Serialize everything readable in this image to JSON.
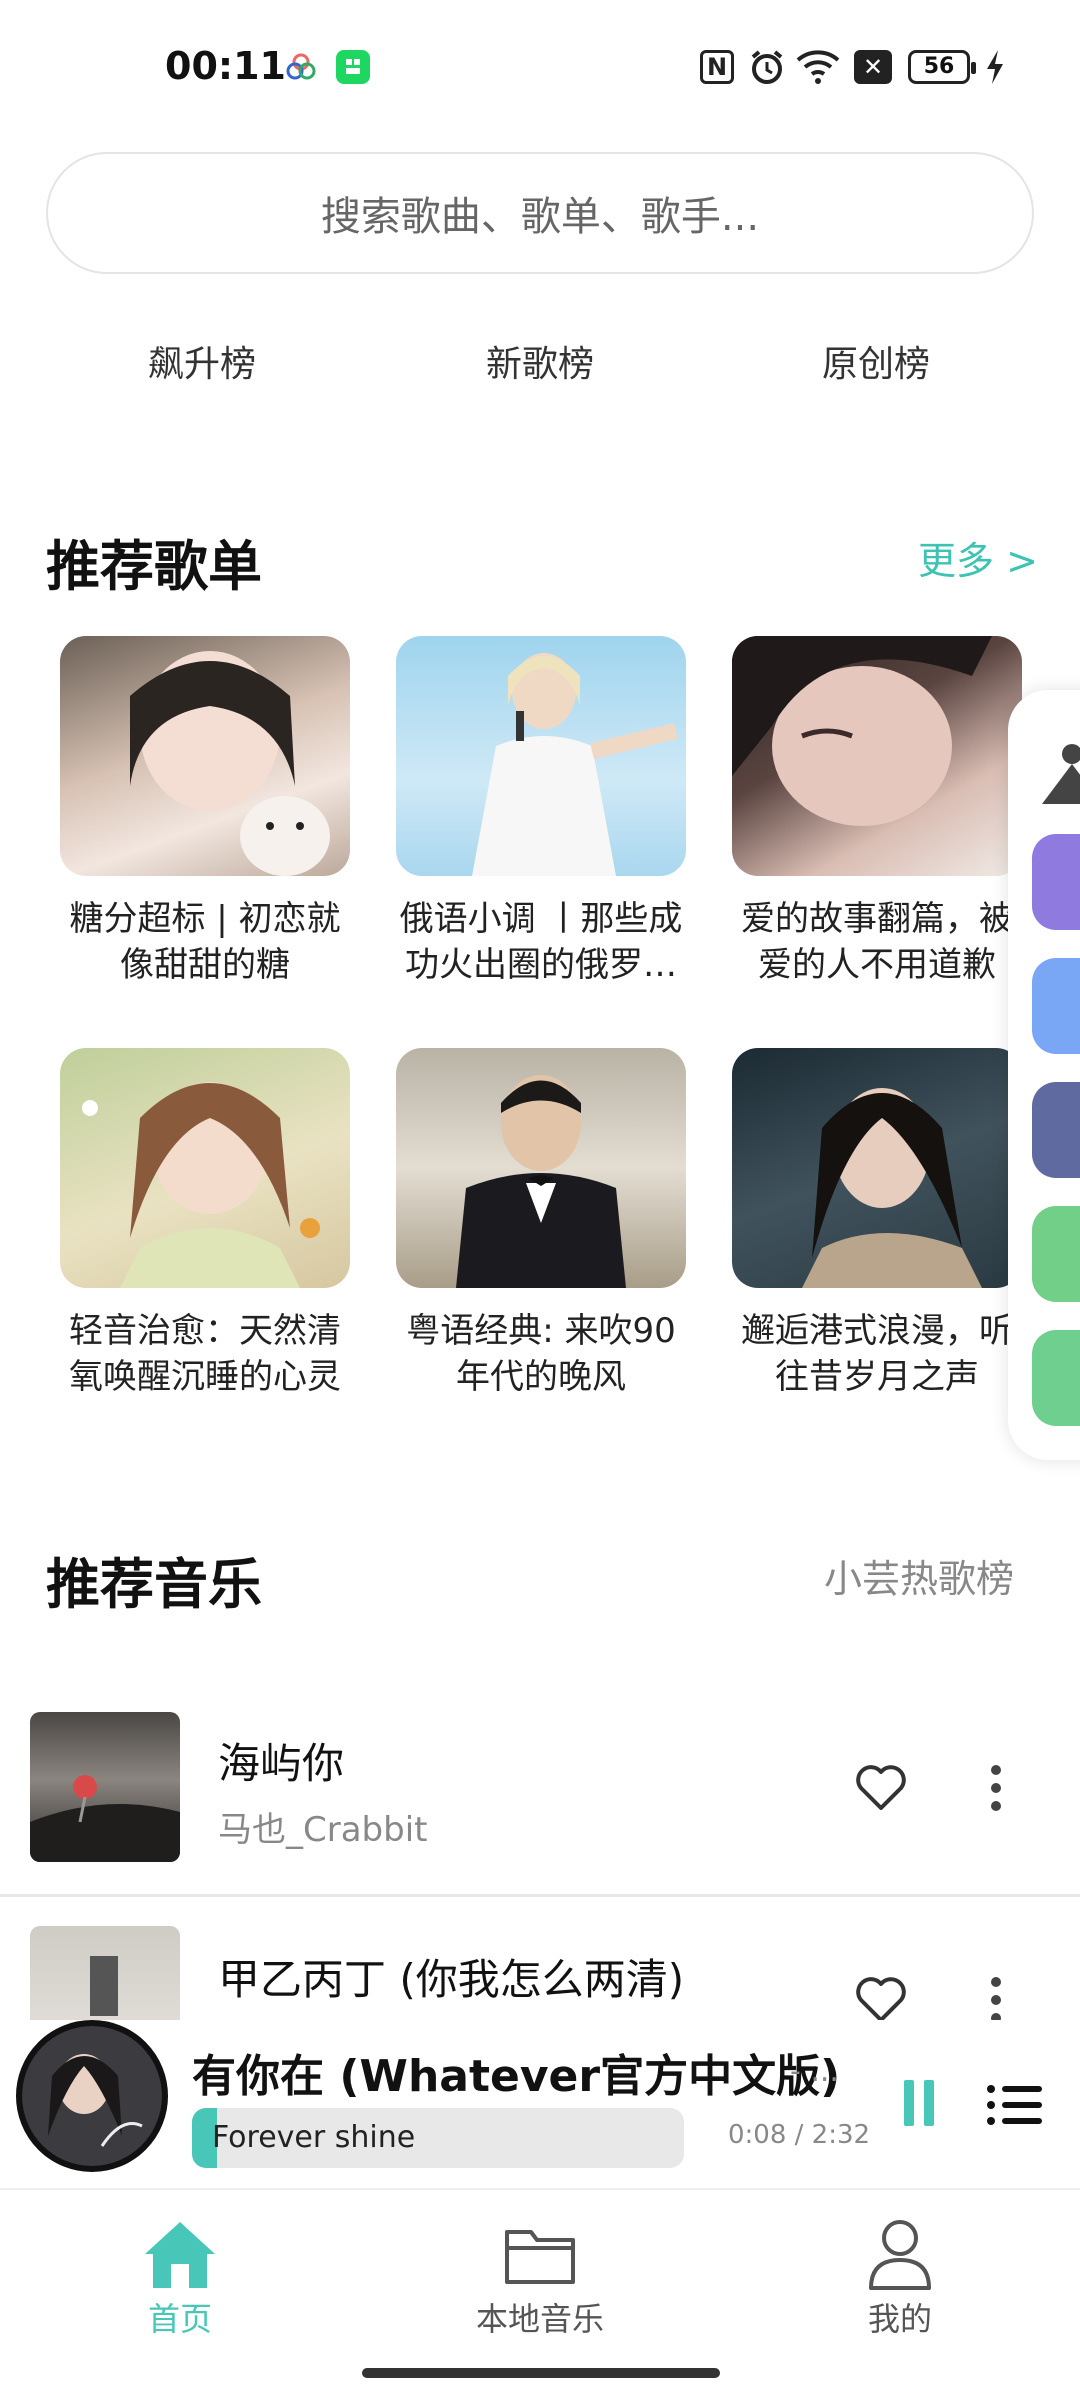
{
  "status_bar": {
    "time": "00:11",
    "battery": "56"
  },
  "search": {
    "placeholder": "搜索歌曲、歌单、歌手..."
  },
  "rank_tabs": [
    "飙升榜",
    "新歌榜",
    "原创榜"
  ],
  "recommended_playlists": {
    "title": "推荐歌单",
    "more": "更多 >",
    "items": [
      {
        "title": "糖分超标 | 初恋就像甜甜的糖"
      },
      {
        "title": "俄语小调 丨那些成功火出圈的俄罗斯歌曲"
      },
      {
        "title": "爱的故事翻篇，被爱的人不用道歉"
      },
      {
        "title": "轻音治愈：天然清氧唤醒沉睡的心灵"
      },
      {
        "title": "粤语经典: 来吹90年代的晚风"
      },
      {
        "title": "邂逅港式浪漫，听往昔岁月之声"
      }
    ]
  },
  "recommended_music": {
    "title": "推荐音乐",
    "link": "小芸热歌榜",
    "songs": [
      {
        "title": "海屿你",
        "artist": "马也_Crabbit"
      },
      {
        "title": "甲乙丙丁 (你我怎么两清)",
        "artist": ""
      }
    ]
  },
  "player": {
    "title": "有你在 (Whatever官方中文版)",
    "suffix": "- ...",
    "lyric": "Forever shine",
    "time": "0:08 / 2:32",
    "progress": 0.05
  },
  "bottom_nav": [
    {
      "label": "首页",
      "icon": "home-icon",
      "active": true
    },
    {
      "label": "本地音乐",
      "icon": "folder-icon",
      "active": false
    },
    {
      "label": "我的",
      "icon": "person-icon",
      "active": false
    }
  ],
  "colors": {
    "accent": "#3cc3b2",
    "text": "#111111",
    "muted": "#888888"
  }
}
